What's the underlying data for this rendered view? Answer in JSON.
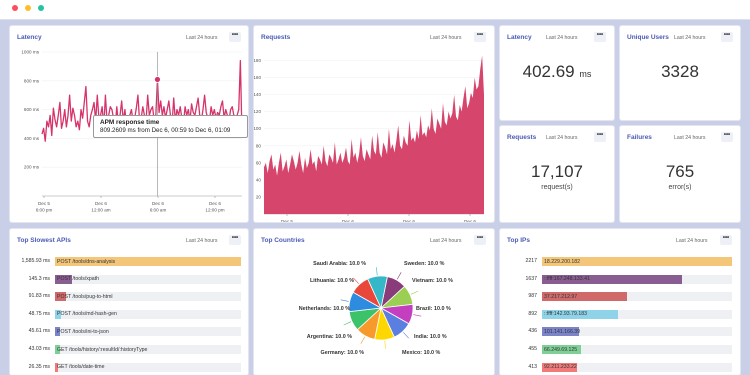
{
  "window": {
    "dots": [
      "#ff4d5e",
      "#ffbd2e",
      "#27c2a5"
    ]
  },
  "range_label": "Last 24 hours",
  "more_label": "•••",
  "latency_chart": {
    "title": "Latency",
    "tooltip": {
      "title": "APM response time",
      "text": "809.2609 ms from Dec 6, 00:59 to Dec 6, 01:09"
    }
  },
  "requests_chart": {
    "title": "Requests"
  },
  "stats": {
    "latency": {
      "title": "Latency",
      "value": "402.69",
      "unit": "ms"
    },
    "unique_users": {
      "title": "Unique Users",
      "value": "3328"
    },
    "requests": {
      "title": "Requests",
      "value": "17,107",
      "label": "request(s)"
    },
    "failures": {
      "title": "Failures",
      "value": "765",
      "label": "error(s)"
    }
  },
  "top_slowest_apis": {
    "title": "Top Slowest APIs",
    "rows": [
      {
        "value": "1,585.93 ms",
        "label": "POST /tools/dns-analysis",
        "fraction": 1.0,
        "color": "#f4c67a"
      },
      {
        "value": "145.3 ms",
        "label": "POST /tools/xpath",
        "fraction": 0.092,
        "color": "#8a5d92"
      },
      {
        "value": "91.83 ms",
        "label": "POST /tools/pug-to-html",
        "fraction": 0.058,
        "color": "#d06a6a"
      },
      {
        "value": "48.75 ms",
        "label": "POST /tools/md-hash-gen",
        "fraction": 0.031,
        "color": "#8fd3e8"
      },
      {
        "value": "45.61 ms",
        "label": "POST /tools/ini-to-json",
        "fraction": 0.029,
        "color": "#7b84c9"
      },
      {
        "value": "43.03 ms",
        "label": "GET /tools/history/:resultId/:historyType",
        "fraction": 0.027,
        "color": "#7fd096"
      },
      {
        "value": "26.35 ms",
        "label": "GET /tools/date-time",
        "fraction": 0.017,
        "color": "#f07a7a"
      }
    ]
  },
  "top_countries": {
    "title": "Top Countries",
    "labels": [
      {
        "text": "Saudi Arabia: 10.0 %"
      },
      {
        "text": "Sweden: 10.0 %"
      },
      {
        "text": "Lithuania: 10.0 %"
      },
      {
        "text": "Vietnam: 10.0 %"
      },
      {
        "text": "Netherlands: 10.0 %"
      },
      {
        "text": "Brazil: 10.0 %"
      },
      {
        "text": "Argentina: 10.0 %"
      },
      {
        "text": "India: 10.0 %"
      },
      {
        "text": "Germany: 10.0 %"
      },
      {
        "text": "Mexico: 10.0 %"
      }
    ]
  },
  "top_ips": {
    "title": "Top IPs",
    "rows": [
      {
        "value": "2217",
        "label": "18.229.200.182",
        "fraction": 1.0,
        "color": "#f4c67a"
      },
      {
        "value": "1637",
        "label": "::ffff:167.248.133.41",
        "fraction": 0.738,
        "color": "#8a5d92"
      },
      {
        "value": "987",
        "label": "37.217.212.97",
        "fraction": 0.445,
        "color": "#d06a6a"
      },
      {
        "value": "892",
        "label": "::ffff:142.93.79.183",
        "fraction": 0.402,
        "color": "#8fd3e8"
      },
      {
        "value": "436",
        "label": "101.141.166.39",
        "fraction": 0.197,
        "color": "#7b84c9"
      },
      {
        "value": "455",
        "label": "66.249.69.125",
        "fraction": 0.205,
        "color": "#7fd096"
      },
      {
        "value": "413",
        "label": "92.211.233.22",
        "fraction": 0.186,
        "color": "#f07a7a"
      }
    ]
  },
  "chart_data": [
    {
      "type": "line",
      "title": "Latency",
      "xlabel": "",
      "ylabel": "",
      "y_tick_labels": [
        "1000 ms",
        "800 ms",
        "600 ms",
        "400 ms",
        "200 ms"
      ],
      "x_tick_labels": [
        "Dec 5\n6:00 pm",
        "Dec 6\n12:00 am",
        "Dec 6\n6:00 am",
        "Dec 6\n12:00 pm"
      ],
      "ylim": [
        0,
        1000
      ],
      "series": [
        {
          "color": "#d6336c",
          "values": [
            430,
            470,
            380,
            520,
            480,
            560,
            420,
            610,
            530,
            480,
            560,
            650,
            470,
            520,
            600,
            480,
            560,
            700,
            520,
            610,
            560,
            480,
            520,
            460,
            600,
            540,
            650,
            760,
            520,
            480,
            560,
            600,
            650,
            520,
            700,
            540,
            560,
            620,
            480,
            700,
            520,
            560,
            620,
            600,
            540,
            480,
            620,
            500,
            560,
            660,
            520,
            600,
            480,
            420,
            560,
            600,
            520,
            540,
            610,
            700,
            520,
            540,
            620,
            560,
            520,
            700,
            560,
            600,
            620,
            520,
            560,
            809,
            580,
            660,
            560,
            620,
            540,
            600,
            660,
            560,
            500,
            680,
            520,
            600,
            560,
            620,
            540,
            500,
            620,
            560,
            600,
            520,
            640,
            580,
            560,
            620,
            680,
            560,
            520,
            600,
            700,
            580,
            540,
            520,
            620,
            560,
            600,
            540,
            580,
            560,
            620,
            660,
            540,
            600,
            560,
            520,
            600,
            620,
            560,
            480,
            560,
            600,
            940,
            420
          ]
        }
      ],
      "highlight": {
        "value": 809.2609
      }
    },
    {
      "type": "area",
      "title": "Requests",
      "xlabel": "",
      "ylabel": "",
      "y_tick_labels": [
        "180",
        "160",
        "140",
        "120",
        "100",
        "80",
        "60",
        "40",
        "20"
      ],
      "x_tick_labels": [
        "Dec 5\n6:00 pm",
        "Dec 6\n12:00 am",
        "Dec 6\n6:00 am",
        "Dec 6\n12:00 pm"
      ],
      "ylim": [
        0,
        190
      ],
      "series": [
        {
          "color": "#d6456c",
          "values": [
            55,
            60,
            48,
            62,
            70,
            52,
            58,
            45,
            60,
            72,
            50,
            56,
            64,
            48,
            58,
            70,
            62,
            52,
            60,
            74,
            58,
            48,
            66,
            54,
            60,
            76,
            58,
            62,
            50,
            68,
            64,
            58,
            80,
            62,
            56,
            70,
            66,
            60,
            84,
            58,
            64,
            72,
            60,
            66,
            78,
            62,
            58,
            88,
            66,
            72,
            60,
            70,
            90,
            68,
            62,
            76,
            70,
            64,
            92,
            74,
            70,
            96,
            72,
            66,
            84,
            78,
            70,
            100,
            76,
            82,
            72,
            86,
            104,
            80,
            76,
            92,
            84,
            80,
            110,
            86,
            90,
            84,
            98,
            88,
            116,
            92,
            96,
            90,
            104,
            98,
            124,
            100,
            94,
            112,
            106,
            100,
            130,
            108,
            104,
            120,
            112,
            118,
            140,
            114,
            110,
            128,
            120,
            136,
            150,
            124,
            130,
            142,
            136,
            160,
            146,
            150,
            170,
            186,
            140
          ]
        }
      ]
    },
    {
      "type": "pie",
      "title": "Top Countries",
      "categories": [
        "Sweden",
        "Vietnam",
        "Brazil",
        "India",
        "Mexico",
        "Germany",
        "Argentina",
        "Netherlands",
        "Lithuania",
        "Saudi Arabia"
      ],
      "values": [
        10.0,
        10.0,
        10.0,
        10.0,
        10.0,
        10.0,
        10.0,
        10.0,
        10.0,
        10.0
      ],
      "colors": [
        "#8a3c7a",
        "#9bcf53",
        "#c43fbf",
        "#5b7fe0",
        "#ffd700",
        "#f89a2b",
        "#3cc36a",
        "#2d8be0",
        "#e8473a",
        "#35b7c7"
      ]
    },
    {
      "type": "bar",
      "title": "Top Slowest APIs",
      "categories": [
        "POST /tools/dns-analysis",
        "POST /tools/xpath",
        "POST /tools/pug-to-html",
        "POST /tools/md-hash-gen",
        "POST /tools/ini-to-json",
        "GET /tools/history/:resultId/:historyType",
        "GET /tools/date-time"
      ],
      "values": [
        1585.93,
        145.3,
        91.83,
        48.75,
        45.61,
        43.03,
        26.35
      ]
    },
    {
      "type": "bar",
      "title": "Top IPs",
      "categories": [
        "18.229.200.182",
        "::ffff:167.248.133.41",
        "37.217.212.97",
        "::ffff:142.93.79.183",
        "101.141.166.39",
        "66.249.69.125",
        "92.211.233.22"
      ],
      "values": [
        2217,
        1637,
        987,
        892,
        436,
        455,
        413
      ]
    }
  ]
}
